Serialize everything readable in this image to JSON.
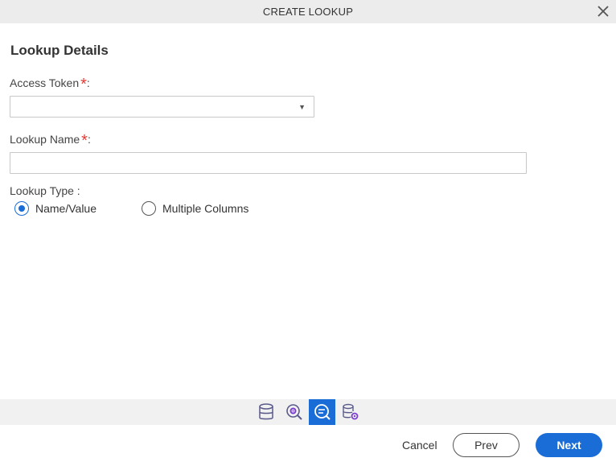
{
  "dialog": {
    "title": "CREATE LOOKUP",
    "close_icon": "close-icon"
  },
  "form": {
    "section_title": "Lookup Details",
    "access_token": {
      "label": "Access Token",
      "required_mark": "*",
      "colon": ":",
      "value": ""
    },
    "lookup_name": {
      "label": "Lookup Name",
      "required_mark": "*",
      "colon": ":",
      "value": ""
    },
    "lookup_type": {
      "label": "Lookup Type :",
      "options": [
        {
          "label": "Name/Value",
          "checked": true
        },
        {
          "label": "Multiple Columns",
          "checked": false
        }
      ]
    }
  },
  "toolbar": {
    "items": [
      {
        "icon": "database-icon",
        "active": false
      },
      {
        "icon": "search-settings-icon",
        "active": false
      },
      {
        "icon": "search-list-icon",
        "active": true
      },
      {
        "icon": "database-settings-icon",
        "active": false
      }
    ]
  },
  "footer": {
    "cancel_label": "Cancel",
    "prev_label": "Prev",
    "next_label": "Next"
  },
  "colors": {
    "accent": "#1a6dd6",
    "required": "#e53935",
    "header_bg": "#ececec"
  }
}
